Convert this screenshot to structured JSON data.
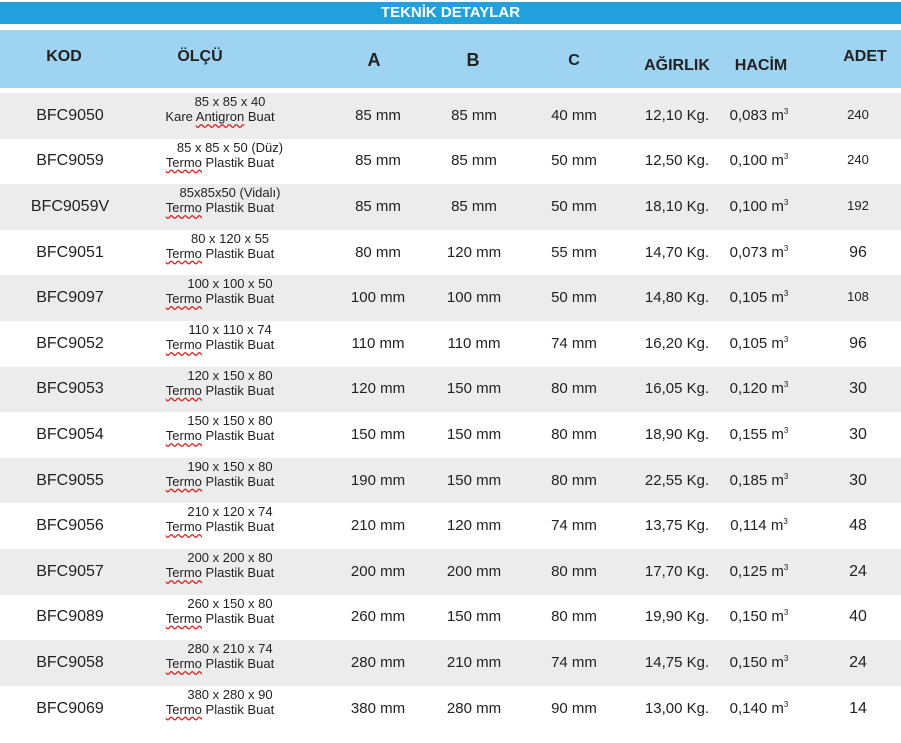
{
  "title": "TEKNİK DETAYLAR",
  "headers": {
    "kod": "KOD",
    "olcu": "ÖLÇÜ",
    "a": "A",
    "b": "B",
    "c": "C",
    "agirlik": "AĞIRLIK",
    "hacim": "HACİM",
    "adet": "ADET"
  },
  "unit_superscript": "3",
  "rows": [
    {
      "kod": "BFC9050",
      "dim": "85 x 85 x 40",
      "desc_pre": "Kare ",
      "desc_word": "Antigron",
      "desc_post": " Buat",
      "a": "85 mm",
      "b": "85 mm",
      "c": "40 mm",
      "agirlik": "12,10  Kg.",
      "hacim": "0,083 m",
      "adet": "240"
    },
    {
      "kod": "BFC9059",
      "dim": "85 x 85 x 50 (Düz)",
      "desc_pre": "",
      "desc_word": "Termo",
      "desc_post": " Plastik Buat",
      "a": "85 mm",
      "b": "85 mm",
      "c": "50 mm",
      "agirlik": "12,50 Kg.",
      "hacim": "0,100 m",
      "adet": "240"
    },
    {
      "kod": "BFC9059V",
      "dim": "85x85x50 (Vidalı)",
      "desc_pre": "",
      "desc_word": "Termo",
      "desc_post": " Plastik Buat",
      "a": "85 mm",
      "b": "85 mm",
      "c": "50 mm",
      "agirlik": "18,10  Kg.",
      "hacim": "0,100 m",
      "adet": "192"
    },
    {
      "kod": "BFC9051",
      "dim": "80 x 120 x 55",
      "desc_pre": "",
      "desc_word": "Termo",
      "desc_post": " Plastik Buat",
      "a": "80 mm",
      "b": "120 mm",
      "c": "55 mm",
      "agirlik": "14,70 Kg.",
      "hacim": "0,073 m",
      "adet": "96"
    },
    {
      "kod": "BFC9097",
      "dim": "100 x 100 x 50",
      "desc_pre": "",
      "desc_word": "Termo",
      "desc_post": " Plastik Buat",
      "a": "100 mm",
      "b": "100 mm",
      "c": "50 mm",
      "agirlik": "14,80 Kg.",
      "hacim": "0,105 m",
      "adet": "108"
    },
    {
      "kod": "BFC9052",
      "dim": "110 x 110 x 74",
      "desc_pre": "",
      "desc_word": "Termo",
      "desc_post": " Plastik Buat",
      "a": "110 mm",
      "b": "110 mm",
      "c": "74 mm",
      "agirlik": "16,20 Kg.",
      "hacim": "0,105 m",
      "adet": "96"
    },
    {
      "kod": "BFC9053",
      "dim": "120 x 150 x 80",
      "desc_pre": "",
      "desc_word": "Termo",
      "desc_post": " Plastik Buat",
      "a": "120 mm",
      "b": "150 mm",
      "c": "80 mm",
      "agirlik": "16,05 Kg.",
      "hacim": "0,120 m",
      "adet": "30"
    },
    {
      "kod": "BFC9054",
      "dim": "150 x 150 x 80",
      "desc_pre": "",
      "desc_word": "Termo",
      "desc_post": " Plastik Buat",
      "a": "150 mm",
      "b": "150 mm",
      "c": "80 mm",
      "agirlik": "18,90 Kg.",
      "hacim": "0,155 m",
      "adet": "30"
    },
    {
      "kod": "BFC9055",
      "dim": "190 x 150 x 80",
      "desc_pre": "",
      "desc_word": "Termo",
      "desc_post": " Plastik Buat",
      "a": "190 mm",
      "b": "150 mm",
      "c": "80 mm",
      "agirlik": "22,55 Kg.",
      "hacim": "0,185 m",
      "adet": "30"
    },
    {
      "kod": "BFC9056",
      "dim": "210 x 120 x 74",
      "desc_pre": "",
      "desc_word": "Termo",
      "desc_post": " Plastik Buat",
      "a": "210 mm",
      "b": "120 mm",
      "c": "74 mm",
      "agirlik": "13,75 Kg.",
      "hacim": "0,114  m",
      "adet": "48"
    },
    {
      "kod": "BFC9057",
      "dim": "200 x 200 x 80",
      "desc_pre": "",
      "desc_word": "Termo",
      "desc_post": " Plastik Buat",
      "a": "200 mm",
      "b": "200 mm",
      "c": "80 mm",
      "agirlik": "17,70 Kg.",
      "hacim": "0,125 m",
      "adet": "24"
    },
    {
      "kod": "BFC9089",
      "dim": "260 x 150 x 80",
      "desc_pre": "",
      "desc_word": "Termo",
      "desc_post": " Plastik Buat",
      "a": "260 mm",
      "b": "150 mm",
      "c": "80 mm",
      "agirlik": "19,90 Kg.",
      "hacim": "0,150 m",
      "adet": "40"
    },
    {
      "kod": "BFC9058",
      "dim": "280 x 210 x 74",
      "desc_pre": "",
      "desc_word": "Termo",
      "desc_post": " Plastik Buat",
      "a": "280 mm",
      "b": "210 mm",
      "c": "74 mm",
      "agirlik": "14,75 Kg.",
      "hacim": "0,150 m",
      "adet": "24"
    },
    {
      "kod": "BFC9069",
      "dim": "380 x 280 x 90",
      "desc_pre": "",
      "desc_word": "Termo",
      "desc_post": " Plastik Buat",
      "a": "380 mm",
      "b": "280 mm",
      "c": "90 mm",
      "agirlik": "13,00 Kg.",
      "hacim": "0,140 m",
      "adet": "14"
    }
  ]
}
